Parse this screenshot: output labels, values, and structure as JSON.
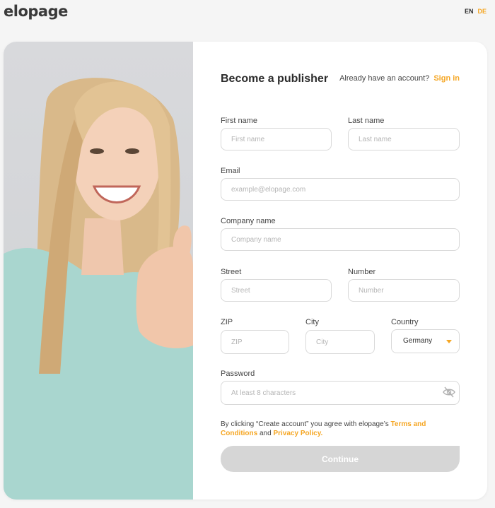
{
  "header": {
    "logo": "elopage",
    "languages": [
      "EN",
      "DE"
    ]
  },
  "form": {
    "title": "Become a publisher",
    "already_account": "Already have an account?",
    "sign_in": "Sign in",
    "first_name": {
      "label": "First name",
      "placeholder": "First name",
      "value": ""
    },
    "last_name": {
      "label": "Last name",
      "placeholder": "Last name",
      "value": ""
    },
    "email": {
      "label": "Email",
      "placeholder": "example@elopage.com",
      "value": ""
    },
    "company": {
      "label": "Company name",
      "placeholder": "Company name",
      "value": ""
    },
    "street": {
      "label": "Street",
      "placeholder": "Street",
      "value": ""
    },
    "number": {
      "label": "Number",
      "placeholder": "Number",
      "value": ""
    },
    "zip": {
      "label": "ZIP",
      "placeholder": "ZIP",
      "value": ""
    },
    "city": {
      "label": "City",
      "placeholder": "City",
      "value": ""
    },
    "country": {
      "label": "Country",
      "value": "Germany"
    },
    "password": {
      "label": "Password",
      "placeholder": "At least 8 characters",
      "value": ""
    },
    "terms": {
      "prefix": "By clicking “Create account” you agree with elopage’s",
      "terms_link": "Terms and Conditions",
      "and": "and",
      "privacy_link": "Privacy Policy."
    },
    "continue_label": "Continue"
  },
  "colors": {
    "accent": "#f5a623",
    "button_disabled": "#d6d6d6",
    "sweater": "#a9d6cf"
  },
  "icons": [
    "eye-slash-icon",
    "chevron-down-icon"
  ]
}
